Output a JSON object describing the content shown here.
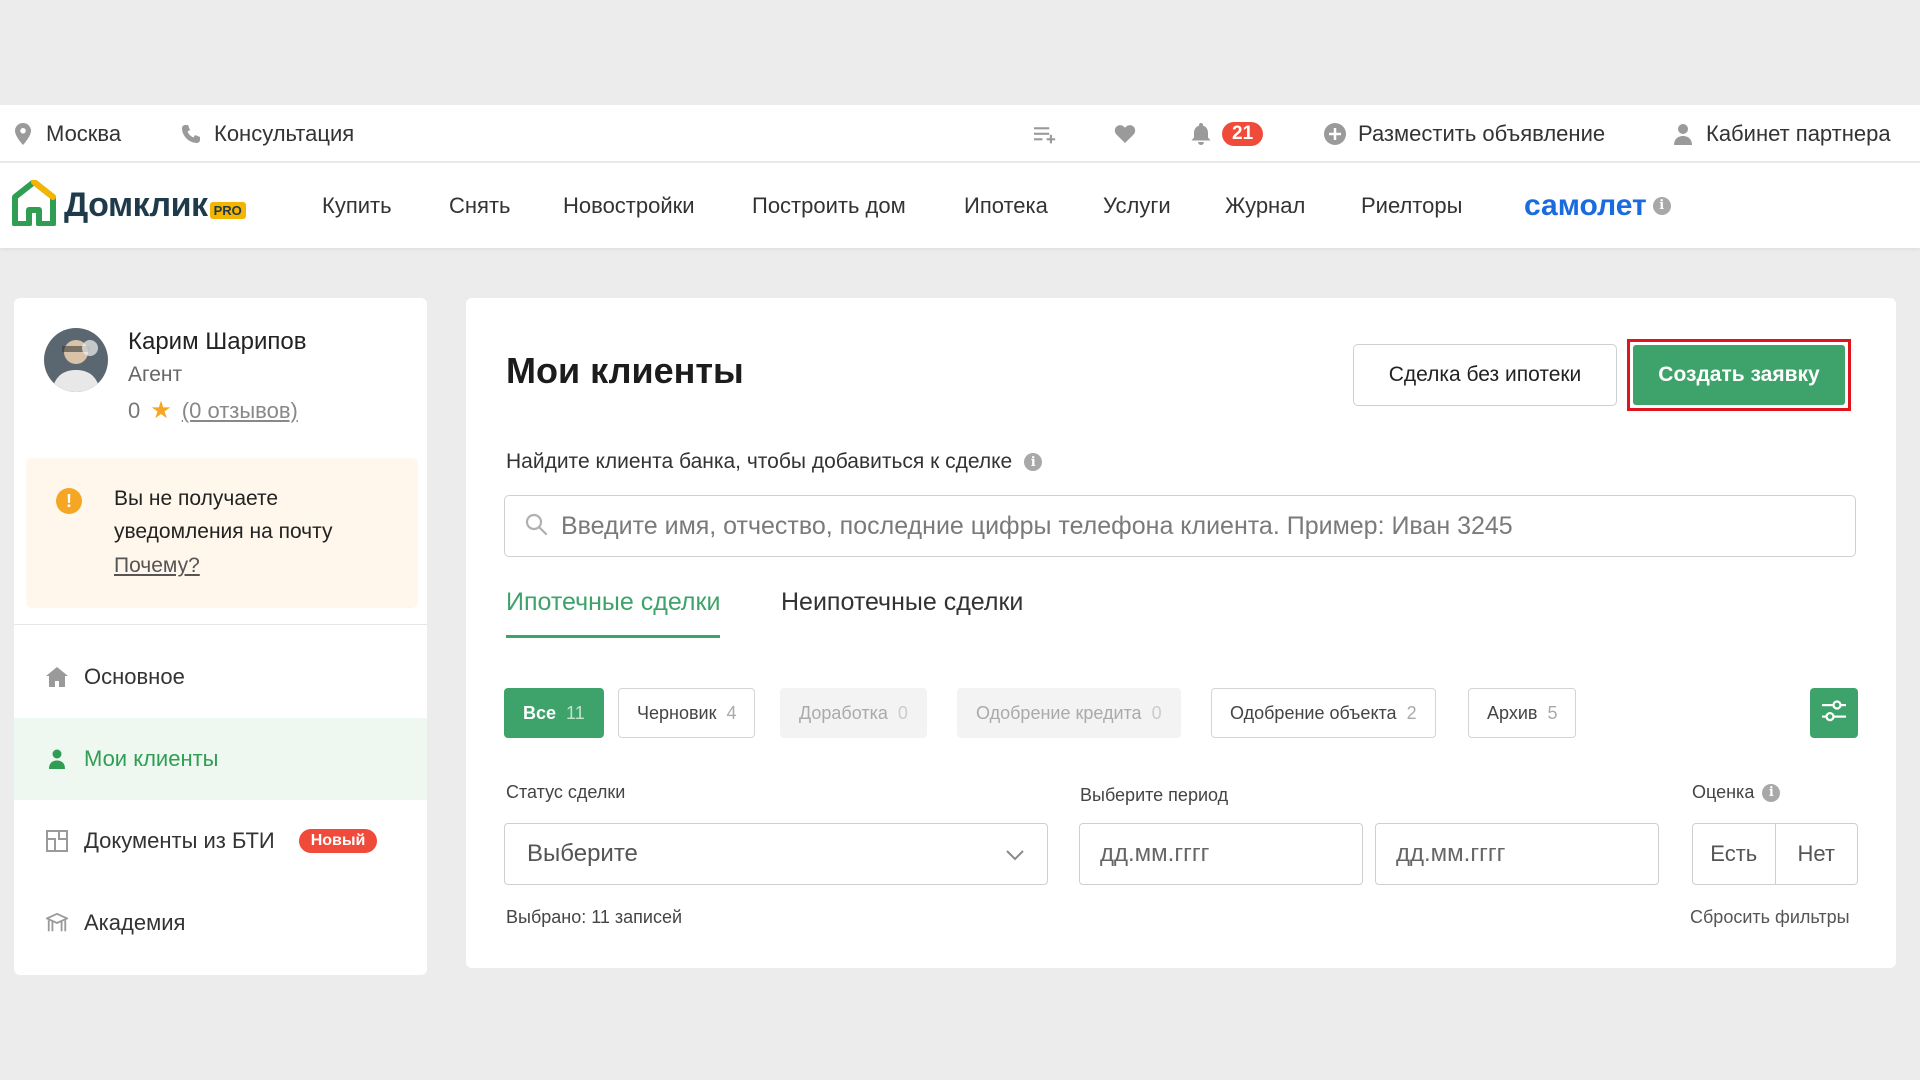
{
  "topbar": {
    "city": "Москва",
    "consult": "Консультация",
    "notifications_count": "21",
    "post_ad": "Разместить объявление",
    "partner_cabinet": "Кабинет партнера"
  },
  "nav": {
    "logo_text": "Домклик",
    "logo_badge": "PRO",
    "links": [
      "Купить",
      "Снять",
      "Новостройки",
      "Построить дом",
      "Ипотека",
      "Услуги",
      "Журнал",
      "Риелторы"
    ],
    "samolet": "самолет"
  },
  "sidebar": {
    "profile": {
      "name": "Карим Шарипов",
      "role": "Агент",
      "rating": "0",
      "reviews": "(0 отзывов)"
    },
    "notice": {
      "text": "Вы не получаете уведомления на почту",
      "link": "Почему?"
    },
    "menu": [
      {
        "label": "Основное",
        "active": false
      },
      {
        "label": "Мои клиенты",
        "active": true
      },
      {
        "label": "Документы из БТИ",
        "badge": "Новый",
        "active": false
      },
      {
        "label": "Академия",
        "active": false
      }
    ]
  },
  "main": {
    "title": "Мои клиенты",
    "btn_no_mortgage": "Сделка без ипотеки",
    "btn_create": "Создать заявку",
    "search_label": "Найдите клиента банка, чтобы добавиться к сделке",
    "search_placeholder": "Введите имя, отчество, последние цифры телефона клиента. Пример: Иван 3245",
    "tabs": [
      "Ипотечные сделки",
      "Неипотечные сделки"
    ],
    "chips": [
      {
        "label": "Все",
        "count": "11",
        "state": "selected"
      },
      {
        "label": "Черновик",
        "count": "4",
        "state": "normal"
      },
      {
        "label": "Доработка",
        "count": "0",
        "state": "disabled"
      },
      {
        "label": "Одобрение кредита",
        "count": "0",
        "state": "disabled"
      },
      {
        "label": "Одобрение объекта",
        "count": "2",
        "state": "normal"
      },
      {
        "label": "Архив",
        "count": "5",
        "state": "normal"
      }
    ],
    "filters": {
      "status_label": "Статус сделки",
      "status_value": "Выберите",
      "period_label": "Выберите период",
      "date_from_placeholder": "дд.мм.гггг",
      "date_to_placeholder": "дд.мм.гггг",
      "rating_label": "Оценка",
      "rating_yes": "Есть",
      "rating_no": "Нет"
    },
    "selected_count": "Выбрано: 11 записей",
    "reset_filters": "Сбросить фильтры"
  },
  "colors": {
    "accent_green": "#3ea36a",
    "badge_red": "#f04b3a",
    "highlight_red": "#e0151c",
    "samolet_blue": "#1a6be0"
  }
}
